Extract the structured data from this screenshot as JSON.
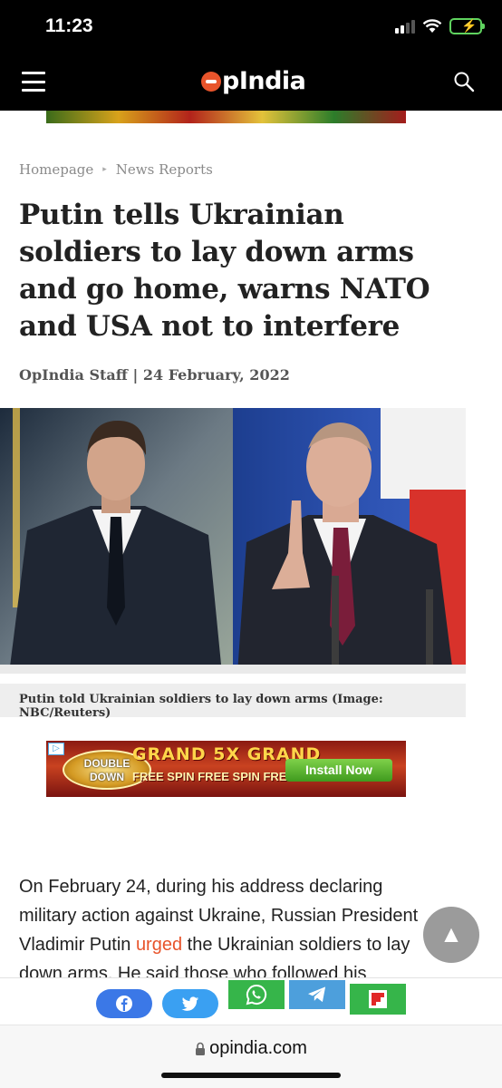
{
  "status_bar": {
    "time": "11:23"
  },
  "header": {
    "logo_text": "pIndia"
  },
  "breadcrumb": {
    "home": "Homepage",
    "section": "News Reports"
  },
  "article": {
    "title": "Putin tells Ukrainian soldiers to lay down arms and go home, warns NATO and USA not to interfere",
    "byline": "OpIndia Staff | 24 February, 2022",
    "image_caption": "Putin told Ukrainian soldiers to lay down arms (Image: NBC/Reuters)",
    "body_before_link": "On February 24, during his address declaring military action against Ukraine, Russian President Vladimir Putin ",
    "body_link": "urged",
    "body_after_link": " the Ukrainian soldiers to lay down arms. He said those who followed his"
  },
  "ad_banner": {
    "logo_line1": "DOUBLE",
    "logo_line2": "DOWN",
    "headline": "GRAND 5X GRAND",
    "subline": "FREE SPIN FREE SPIN FREE SPIN",
    "cta": "Install Now"
  },
  "browser": {
    "url": "opindia.com"
  },
  "colors": {
    "brand_orange": "#e8542b",
    "facebook": "#3b78e7",
    "twitter": "#3aa0f2",
    "whatsapp": "#36b54a",
    "telegram": "#4d9fdc"
  }
}
